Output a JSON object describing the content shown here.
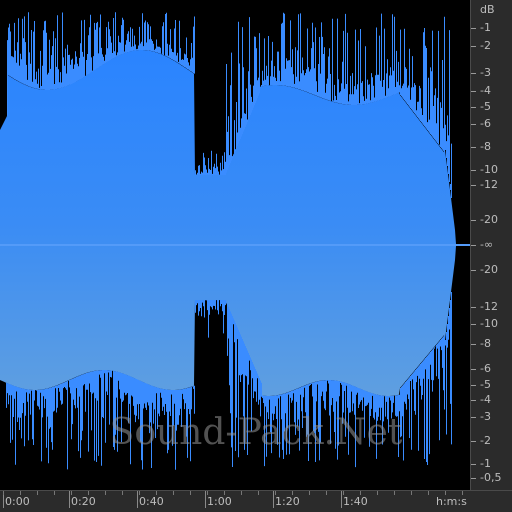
{
  "colors": {
    "background": "#000000",
    "waveform_top": "#2e88ff",
    "waveform_bottom": "#5fa3e8",
    "ruler_bg": "#2b2b2b",
    "ruler_text": "#bdbdbd"
  },
  "db_ruler": {
    "unit": "dB",
    "labels_top": [
      "-1",
      "-2",
      "-3",
      "-4",
      "-5",
      "-6",
      "-8",
      "-10",
      "-12",
      "-20"
    ],
    "center": "-∞",
    "labels_bottom": [
      "-20",
      "-12",
      "-10",
      "-8",
      "-6",
      "-5",
      "-4",
      "-3",
      "-2",
      "-1",
      "-0,5"
    ]
  },
  "time_ruler": {
    "labels": [
      "0:00",
      "0:20",
      "0:40",
      "1:00",
      "1:20",
      "1:40"
    ],
    "units": "h:m:s"
  },
  "watermark": "Sound-Pack.Net"
}
